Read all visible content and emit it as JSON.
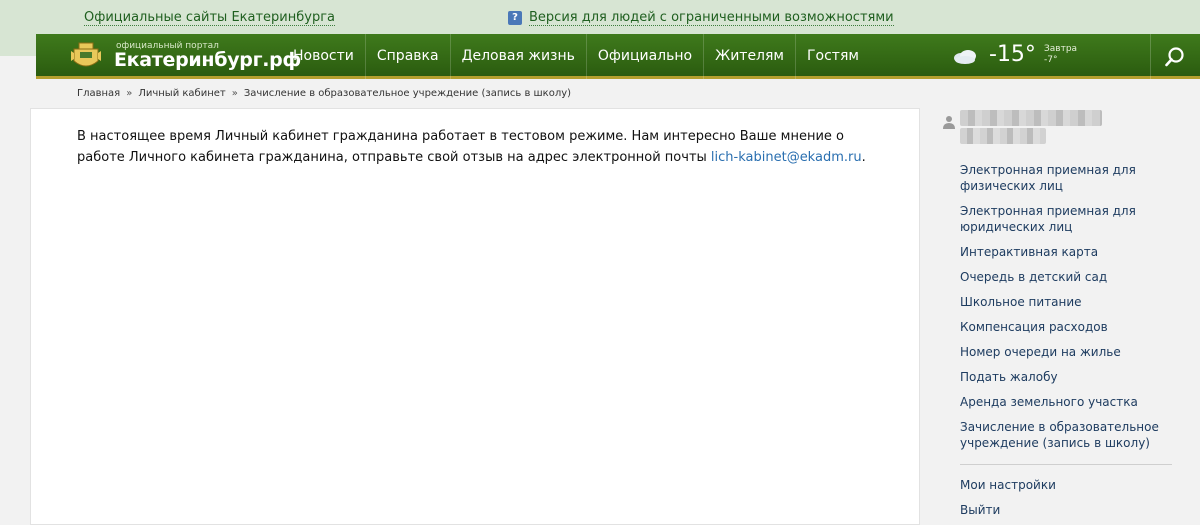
{
  "topbar": {
    "sites_link": "Официальные сайты Екатеринбурга",
    "accessibility_link": "Версия для людей с ограниченными возможностями",
    "accessibility_icon_glyph": "?"
  },
  "header": {
    "portal_small": "официальный портал",
    "portal_name": "Екатеринбург.рф",
    "menu": [
      {
        "label": "Новости"
      },
      {
        "label": "Справка"
      },
      {
        "label": "Деловая жизнь"
      },
      {
        "label": "Официально"
      },
      {
        "label": "Жителям"
      },
      {
        "label": "Гостям"
      }
    ],
    "weather": {
      "icon": "cloud-icon",
      "temperature": "-15°",
      "tomorrow_label": "Завтра",
      "tomorrow_temp": "-7°"
    },
    "search_icon": "search-icon"
  },
  "breadcrumb": {
    "items": [
      "Главная",
      "Личный кабинет",
      "Зачисление в образовательное учреждение (запись в школу)"
    ],
    "separator": "»"
  },
  "content": {
    "notice_text": "В настоящее время Личный кабинет гражданина работает в тестовом режиме. Нам интересно Ваше мнение о работе Личного кабинета гражданина, отправьте свой отзыв на адрес электронной почты ",
    "email": "lich-kabinet@ekadm.ru",
    "notice_end": "."
  },
  "sidebar": {
    "user_icon": "user-icon",
    "links": [
      {
        "label": "Электронная приемная для физических лиц"
      },
      {
        "label": "Электронная приемная для юридических лиц"
      },
      {
        "label": "Интерактивная карта"
      },
      {
        "label": "Очередь в детский сад"
      },
      {
        "label": "Школьное питание"
      },
      {
        "label": "Компенсация расходов"
      },
      {
        "label": "Номер очереди на жилье"
      },
      {
        "label": "Подать жалобу"
      },
      {
        "label": "Аренда земельного участка"
      },
      {
        "label": "Зачисление в образовательное учреждение (запись в школу)"
      }
    ],
    "settings": "Мои настройки",
    "logout": "Выйти"
  },
  "colors": {
    "nav_green": "#2b5c0f",
    "top_strip": "#d7e5d3",
    "link_blue": "#2a6fb0"
  }
}
